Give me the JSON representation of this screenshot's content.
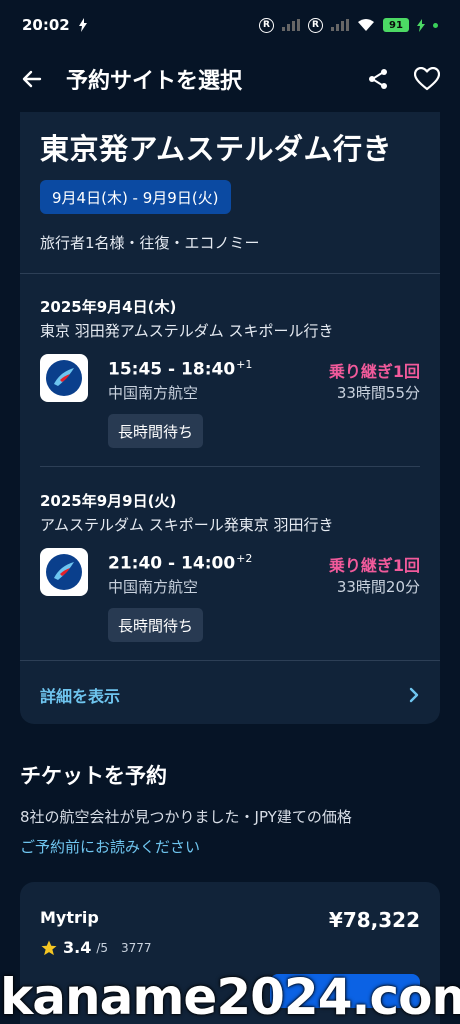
{
  "status_bar": {
    "time": "20:02",
    "battery": "91"
  },
  "appbar": {
    "title": "予約サイトを選択"
  },
  "trip": {
    "destination_title": "東京発アムステルダム行き",
    "date_range": "9月4日(木) - 9月9日(火)",
    "travelers": "旅行者1名様・往復・エコノミー"
  },
  "legs": [
    {
      "date": "2025年9月4日(木)",
      "route": "東京 羽田発アムステルダム スキポール行き",
      "depart": "15:45",
      "arrive": "18:40",
      "day_offset": "+1",
      "airline": "中国南方航空",
      "stops": "乗り継ぎ1回",
      "duration": "33時間55分",
      "badge": "長時間待ち"
    },
    {
      "date": "2025年9月9日(火)",
      "route": "アムステルダム スキポール発東京 羽田行き",
      "depart": "21:40",
      "arrive": "14:00",
      "day_offset": "+2",
      "airline": "中国南方航空",
      "stops": "乗り継ぎ1回",
      "duration": "33時間20分",
      "badge": "長時間待ち"
    }
  ],
  "details_link": "詳細を表示",
  "tickets": {
    "title": "チケットを予約",
    "subtitle": "8社の航空会社が見つかりました・JPY建ての価格",
    "notice_link": "ご予約前にお読みください",
    "offers": [
      {
        "provider": "Mytrip",
        "price": "¥78,322",
        "rating": "3.4",
        "rating_max": "/5",
        "review_count": "3777"
      }
    ]
  },
  "watermark": "kaname2024.com",
  "colors": {
    "background": "#061426",
    "card": "#112339",
    "accent_blue": "#0b4aa2",
    "link": "#6fc5ef",
    "stops_pink": "#f15a9b"
  }
}
